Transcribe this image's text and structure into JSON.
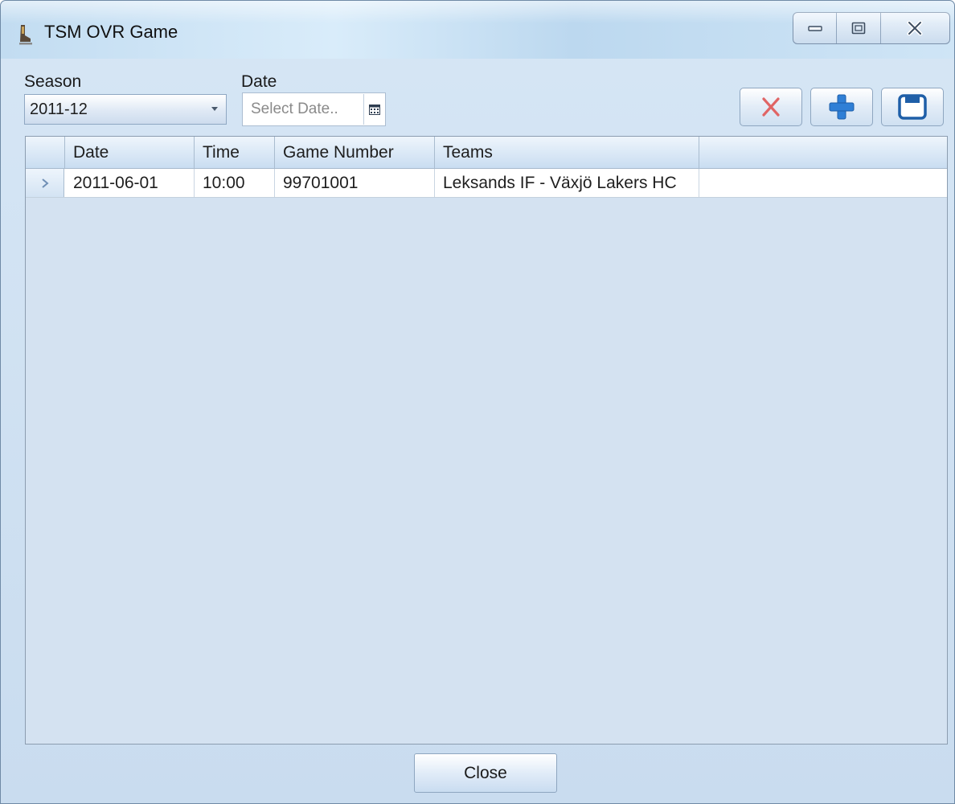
{
  "window": {
    "title": "TSM OVR Game",
    "icon": "skate-icon"
  },
  "filters": {
    "season_label": "Season",
    "season_value": "2011-12",
    "date_label": "Date",
    "date_placeholder": "Select Date.."
  },
  "toolbar": {
    "delete_icon": "x-delete-icon",
    "add_icon": "plus-add-icon",
    "save_icon": "floppy-save-icon",
    "colors": {
      "delete": "#e06565",
      "add": "#2f7fd6",
      "save": "#1f5fa8"
    }
  },
  "grid": {
    "columns": [
      "Date",
      "Time",
      "Game Number",
      "Teams"
    ],
    "rows": [
      {
        "date": "2011-06-01",
        "time": "10:00",
        "game_number": "99701001",
        "teams": "Leksands IF - Växjö Lakers HC"
      }
    ]
  },
  "footer": {
    "close_label": "Close"
  }
}
